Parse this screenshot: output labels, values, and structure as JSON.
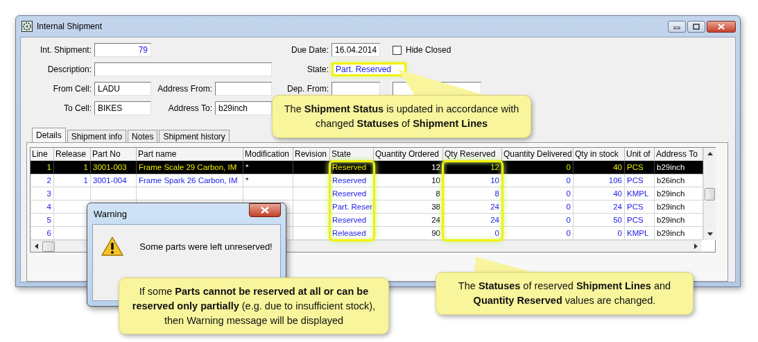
{
  "window": {
    "title": "Internal Shipment"
  },
  "form": {
    "int_shipment": {
      "label": "Int. Shipment:",
      "value": "79"
    },
    "description": {
      "label": "Description:"
    },
    "from_cell": {
      "label": "From Cell:",
      "value": "LADU"
    },
    "to_cell": {
      "label": "To Cell:",
      "value": "BIKES"
    },
    "address_from": {
      "label": "Address From:"
    },
    "address_to": {
      "label": "Address To:",
      "value": "b29inch"
    },
    "due_date": {
      "label": "Due Date:",
      "value": "16.04.2014"
    },
    "hide_closed": {
      "label": "Hide Closed",
      "checked": false
    },
    "state": {
      "label": "State:",
      "value": "Part. Reserved"
    },
    "dep_from": {
      "label": "Dep. From:"
    }
  },
  "tabs": [
    {
      "label": "Details",
      "selected": true
    },
    {
      "label": "Shipment info",
      "selected": false
    },
    {
      "label": "Notes",
      "selected": false
    },
    {
      "label": "Shipment history",
      "selected": false
    }
  ],
  "table": {
    "columns": [
      "Line",
      "Release",
      "Part No",
      "Part name",
      "Modification",
      "Revision",
      "State",
      "Quantity Ordered",
      "Qty Reserved",
      "Quantity Delivered",
      "Qty in stock",
      "Unit of",
      "Address To"
    ],
    "rows": [
      {
        "selected": true,
        "line": "1",
        "release": "1",
        "part_no": "3001-003",
        "part_name": "Frame Scale 29 Carbon, IM",
        "modification": "*",
        "state": "Reserved",
        "quantity_ordered": "12",
        "qty_reserved": "12",
        "quantity_delivered": "0",
        "qty_in_stock": "40",
        "unit_of": "PCS",
        "address_to": "b29inch"
      },
      {
        "selected": false,
        "line": "2",
        "release": "1",
        "part_no": "3001-004",
        "part_name": "Frame Spark 26 Carbon, IM",
        "modification": "*",
        "state": "Reserved",
        "quantity_ordered": "10",
        "qty_reserved": "10",
        "quantity_delivered": "0",
        "qty_in_stock": "106",
        "unit_of": "PCS",
        "address_to": "b26inch"
      },
      {
        "selected": false,
        "line": "3",
        "state": "Reserved",
        "quantity_ordered": "8",
        "qty_reserved": "8",
        "quantity_delivered": "0",
        "qty_in_stock": "40",
        "unit_of": "KMPL",
        "address_to": "b29inch"
      },
      {
        "selected": false,
        "line": "4",
        "state": "Part. Reser",
        "quantity_ordered": "38",
        "qty_reserved": "24",
        "quantity_delivered": "0",
        "qty_in_stock": "24",
        "unit_of": "PCS",
        "address_to": "b29inch"
      },
      {
        "selected": false,
        "line": "5",
        "state": "Reserved",
        "quantity_ordered": "24",
        "qty_reserved": "24",
        "quantity_delivered": "0",
        "qty_in_stock": "50",
        "unit_of": "PCS",
        "address_to": "b29inch"
      },
      {
        "selected": false,
        "line": "6",
        "state": "Released",
        "quantity_ordered": "90",
        "qty_reserved": "0",
        "quantity_delivered": "0",
        "qty_in_stock": "0",
        "unit_of": "KMPL",
        "address_to": "b29inch"
      }
    ]
  },
  "dialog": {
    "title": "Warning",
    "message": "Some parts were left unreserved!"
  },
  "callouts": [
    {
      "text": "The **Shipment Status** is updated in accordance with changed **Statuses** of **Shipment Lines**"
    },
    {
      "text": "If some **Parts cannot be reserved at all or can be reserved only partially** (e.g. due to insufficient stock), then Warning message will be displayed"
    },
    {
      "text": "The **Statuses** of reserved **Shipment Lines** and **Quantity Reserved** values are changed."
    }
  ]
}
